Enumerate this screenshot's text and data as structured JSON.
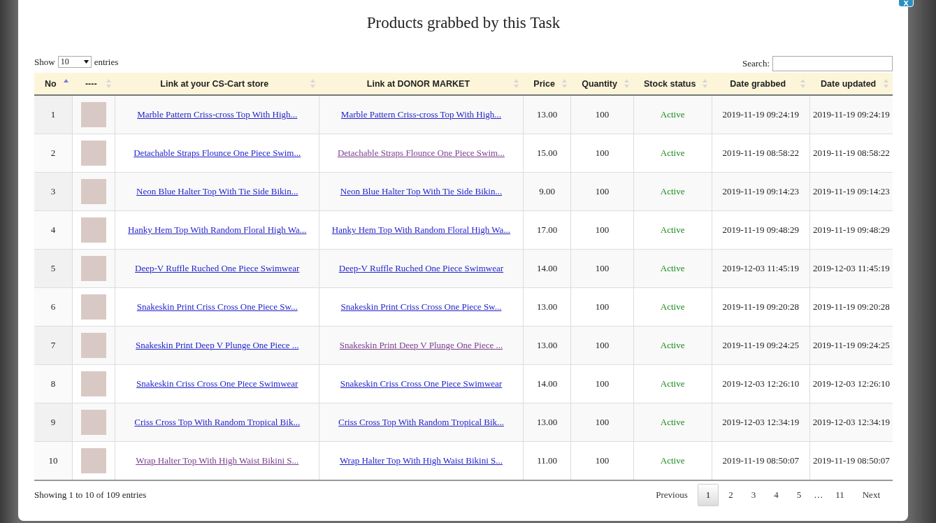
{
  "dialog": {
    "title": "Products grabbed by this Task",
    "close_label": "x"
  },
  "length_menu": {
    "before": "Show",
    "value": "10",
    "after": "entries"
  },
  "search": {
    "label": "Search:"
  },
  "table": {
    "columns": [
      {
        "label": "No",
        "sorted_ascending": true
      },
      {
        "label": "----",
        "sorted_ascending": false
      },
      {
        "label": "Link at your CS-Cart store",
        "sorted_ascending": false
      },
      {
        "label": "Link at DONOR MARKET",
        "sorted_ascending": false
      },
      {
        "label": "Price",
        "sorted_ascending": false
      },
      {
        "label": "Quantity",
        "sorted_ascending": false
      },
      {
        "label": "Stock status",
        "sorted_ascending": false
      },
      {
        "label": "Date grabbed",
        "sorted_ascending": false
      },
      {
        "label": "Date updated",
        "sorted_ascending": false
      }
    ],
    "rows": [
      {
        "no": "1",
        "store_link": {
          "text": "Marble Pattern Criss-cross Top With High...",
          "visited": false
        },
        "donor_link": {
          "text": "Marble Pattern Criss-cross Top With High...",
          "visited": false
        },
        "price": "13.00",
        "quantity": "100",
        "stock_status": "Active",
        "date_grabbed": "2019-11-19 09:24:19",
        "date_updated": "2019-11-19 09:24:19"
      },
      {
        "no": "2",
        "store_link": {
          "text": "Detachable Straps Flounce One Piece Swim...",
          "visited": false
        },
        "donor_link": {
          "text": "Detachable Straps Flounce One Piece Swim...",
          "visited": true
        },
        "price": "15.00",
        "quantity": "100",
        "stock_status": "Active",
        "date_grabbed": "2019-11-19 08:58:22",
        "date_updated": "2019-11-19 08:58:22"
      },
      {
        "no": "3",
        "store_link": {
          "text": "Neon Blue Halter Top With Tie Side Bikin...",
          "visited": false
        },
        "donor_link": {
          "text": "Neon Blue Halter Top With Tie Side Bikin...",
          "visited": false
        },
        "price": "9.00",
        "quantity": "100",
        "stock_status": "Active",
        "date_grabbed": "2019-11-19 09:14:23",
        "date_updated": "2019-11-19 09:14:23"
      },
      {
        "no": "4",
        "store_link": {
          "text": "Hanky Hem Top With Random Floral High Wa...",
          "visited": false
        },
        "donor_link": {
          "text": "Hanky Hem Top With Random Floral High Wa...",
          "visited": false
        },
        "price": "17.00",
        "quantity": "100",
        "stock_status": "Active",
        "date_grabbed": "2019-11-19 09:48:29",
        "date_updated": "2019-11-19 09:48:29"
      },
      {
        "no": "5",
        "store_link": {
          "text": "Deep-V Ruffle Ruched One Piece Swimwear",
          "visited": false
        },
        "donor_link": {
          "text": "Deep-V Ruffle Ruched One Piece Swimwear",
          "visited": false
        },
        "price": "14.00",
        "quantity": "100",
        "stock_status": "Active",
        "date_grabbed": "2019-12-03 11:45:19",
        "date_updated": "2019-12-03 11:45:19"
      },
      {
        "no": "6",
        "store_link": {
          "text": "Snakeskin Print Criss Cross One Piece Sw...",
          "visited": false
        },
        "donor_link": {
          "text": "Snakeskin Print Criss Cross One Piece Sw...",
          "visited": false
        },
        "price": "13.00",
        "quantity": "100",
        "stock_status": "Active",
        "date_grabbed": "2019-11-19 09:20:28",
        "date_updated": "2019-11-19 09:20:28"
      },
      {
        "no": "7",
        "store_link": {
          "text": "Snakeskin Print Deep V Plunge One Piece ...",
          "visited": false
        },
        "donor_link": {
          "text": "Snakeskin Print Deep V Plunge One Piece ...",
          "visited": true
        },
        "price": "13.00",
        "quantity": "100",
        "stock_status": "Active",
        "date_grabbed": "2019-11-19 09:24:25",
        "date_updated": "2019-11-19 09:24:25"
      },
      {
        "no": "8",
        "store_link": {
          "text": "Snakeskin Criss Cross One Piece Swimwear",
          "visited": false
        },
        "donor_link": {
          "text": "Snakeskin Criss Cross One Piece Swimwear",
          "visited": false
        },
        "price": "14.00",
        "quantity": "100",
        "stock_status": "Active",
        "date_grabbed": "2019-12-03 12:26:10",
        "date_updated": "2019-12-03 12:26:10"
      },
      {
        "no": "9",
        "store_link": {
          "text": "Criss Cross Top With Random Tropical Bik...",
          "visited": false
        },
        "donor_link": {
          "text": "Criss Cross Top With Random Tropical Bik...",
          "visited": false
        },
        "price": "13.00",
        "quantity": "100",
        "stock_status": "Active",
        "date_grabbed": "2019-12-03 12:34:19",
        "date_updated": "2019-12-03 12:34:19"
      },
      {
        "no": "10",
        "store_link": {
          "text": "Wrap Halter Top With High Waist Bikini S...",
          "visited": true
        },
        "donor_link": {
          "text": "Wrap Halter Top With High Waist Bikini S...",
          "visited": false
        },
        "price": "11.00",
        "quantity": "100",
        "stock_status": "Active",
        "date_grabbed": "2019-11-19 08:50:07",
        "date_updated": "2019-11-19 08:50:07"
      }
    ]
  },
  "info": "Showing 1 to 10 of 109 entries",
  "pagination": {
    "previous": "Previous",
    "next": "Next",
    "pages": [
      {
        "kind": "page",
        "label": "1",
        "selected": true
      },
      {
        "kind": "page",
        "label": "2",
        "selected": false
      },
      {
        "kind": "page",
        "label": "3",
        "selected": false
      },
      {
        "kind": "page",
        "label": "4",
        "selected": false
      },
      {
        "kind": "page",
        "label": "5",
        "selected": false
      },
      {
        "kind": "ellipsis",
        "label": "…"
      },
      {
        "kind": "page",
        "label": "11",
        "selected": false
      }
    ]
  }
}
